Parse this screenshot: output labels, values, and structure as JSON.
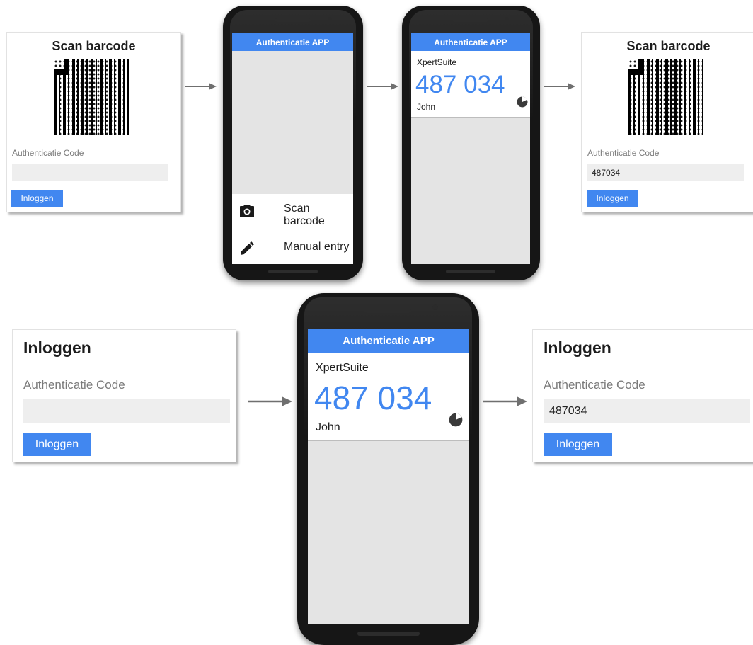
{
  "top_left_card": {
    "title": "Scan barcode",
    "code_label": "Authenticatie Code",
    "code_value": "",
    "button_label": "Inloggen"
  },
  "phone_scan": {
    "app_title": "Authenticatie APP",
    "menu_items": [
      {
        "label": "Scan barcode",
        "icon": "camera-icon"
      },
      {
        "label": "Manual entry",
        "icon": "pencil-icon"
      }
    ]
  },
  "phone_token_small": {
    "app_title": "Authenticatie APP",
    "issuer": "XpertSuite",
    "code": "487 034",
    "user": "John",
    "timer_remaining": 0.78
  },
  "top_right_card": {
    "title": "Scan barcode",
    "code_label": "Authenticatie Code",
    "code_value": "487034",
    "button_label": "Inloggen"
  },
  "bottom_left_card": {
    "title": "Inloggen",
    "code_label": "Authenticatie Code",
    "code_value": "",
    "button_label": "Inloggen"
  },
  "phone_token_large": {
    "app_title": "Authenticatie APP",
    "issuer": "XpertSuite",
    "code": "487 034",
    "user": "John",
    "timer_remaining": 0.78
  },
  "bottom_right_card": {
    "title": "Inloggen",
    "code_label": "Authenticatie Code",
    "code_value": "487034",
    "button_label": "Inloggen"
  },
  "colors": {
    "accent": "#4187f0",
    "input_bg": "#eeeeee",
    "label_gray": "#7a7a7a",
    "phone_body": "#161616",
    "screen_bg": "#e4e4e4",
    "arrow": "#6f6f6f"
  }
}
